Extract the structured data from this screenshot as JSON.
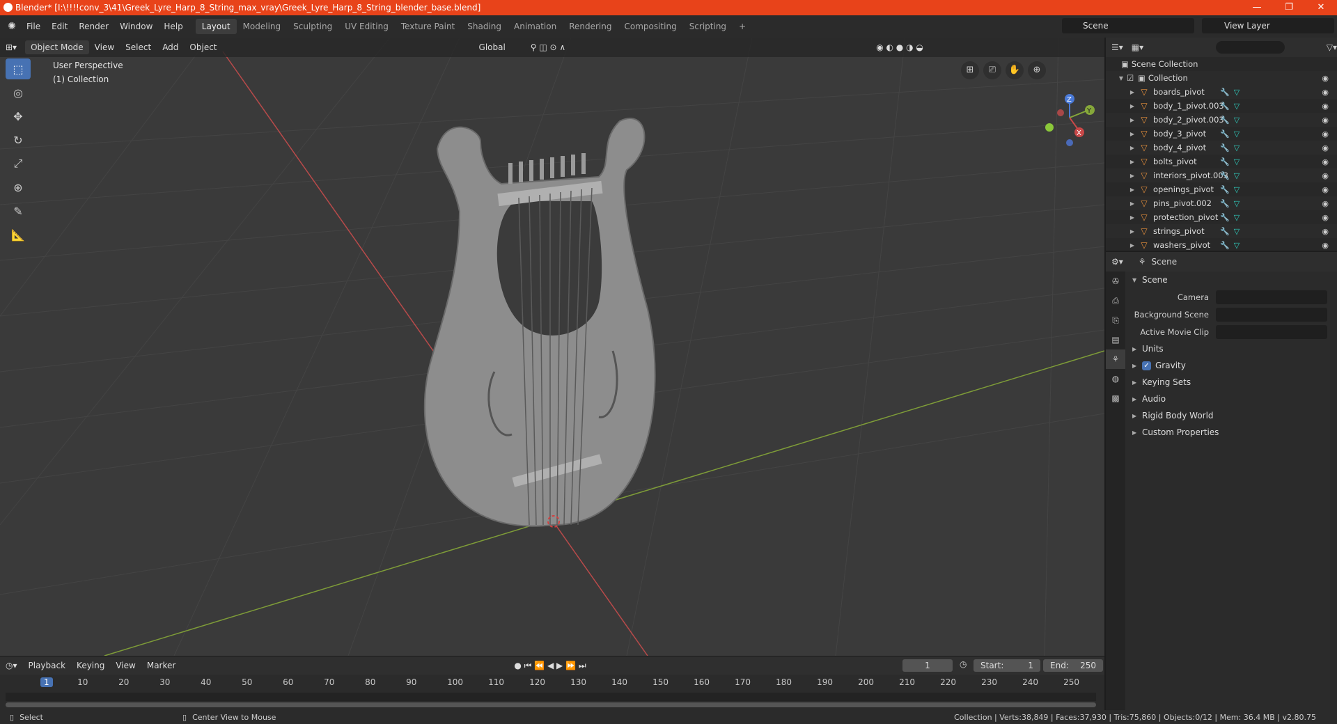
{
  "window": {
    "title": "Blender* [I:\\!!!!conv_3\\41\\Greek_Lyre_Harp_8_String_max_vray\\Greek_Lyre_Harp_8_String_blender_base.blend]",
    "minimize": "—",
    "maximize": "❐",
    "close": "✕"
  },
  "menu": [
    "File",
    "Edit",
    "Render",
    "Window",
    "Help"
  ],
  "workspaces": [
    "Layout",
    "Modeling",
    "Sculpting",
    "UV Editing",
    "Texture Paint",
    "Shading",
    "Animation",
    "Rendering",
    "Compositing",
    "Scripting"
  ],
  "active_workspace": "Layout",
  "scene_name": "Scene",
  "view_layer": "View Layer",
  "viewport": {
    "mode": "Object Mode",
    "menus": [
      "View",
      "Select",
      "Add",
      "Object"
    ],
    "orientation": "Global",
    "perspective_label": "User Perspective",
    "collection_label": "(1) Collection"
  },
  "gizmo": {
    "z": "Z",
    "y": "Y",
    "x": "X"
  },
  "timeline": {
    "menus": [
      "Playback",
      "Keying",
      "View",
      "Marker"
    ],
    "current_frame": "1",
    "start_label": "Start:",
    "start": "1",
    "end_label": "End:",
    "end": "250",
    "ticks": [
      "1",
      "10",
      "20",
      "30",
      "40",
      "50",
      "60",
      "70",
      "80",
      "90",
      "100",
      "110",
      "120",
      "130",
      "140",
      "150",
      "160",
      "170",
      "180",
      "190",
      "200",
      "210",
      "220",
      "230",
      "240",
      "250"
    ]
  },
  "outliner": {
    "root": "Scene Collection",
    "collection": "Collection",
    "items": [
      "boards_pivot",
      "body_1_pivot.003",
      "body_2_pivot.003",
      "body_3_pivot",
      "body_4_pivot",
      "bolts_pivot",
      "interiors_pivot.003",
      "openings_pivot",
      "pins_pivot.002",
      "protection_pivot",
      "strings_pivot",
      "washers_pivot"
    ]
  },
  "properties": {
    "header": "Scene",
    "section": "Scene",
    "camera_label": "Camera",
    "background_label": "Background Scene",
    "movie_clip_label": "Active Movie Clip",
    "panels": [
      "Units",
      "Gravity",
      "Keying Sets",
      "Audio",
      "Rigid Body World",
      "Custom Properties"
    ]
  },
  "status": {
    "select": "Select",
    "center": "Center View to Mouse",
    "stats": "Collection | Verts:38,849 | Faces:37,930 | Tris:75,860 | Objects:0/12 | Mem: 36.4 MB | v2.80.75"
  },
  "colors": {
    "title_bar": "#e8431a",
    "accent": "#4772b3",
    "object_icon": "#e8913c",
    "x_axis": "#c84848",
    "y_axis": "#86a83a",
    "z_axis": "#4a7ad8"
  }
}
